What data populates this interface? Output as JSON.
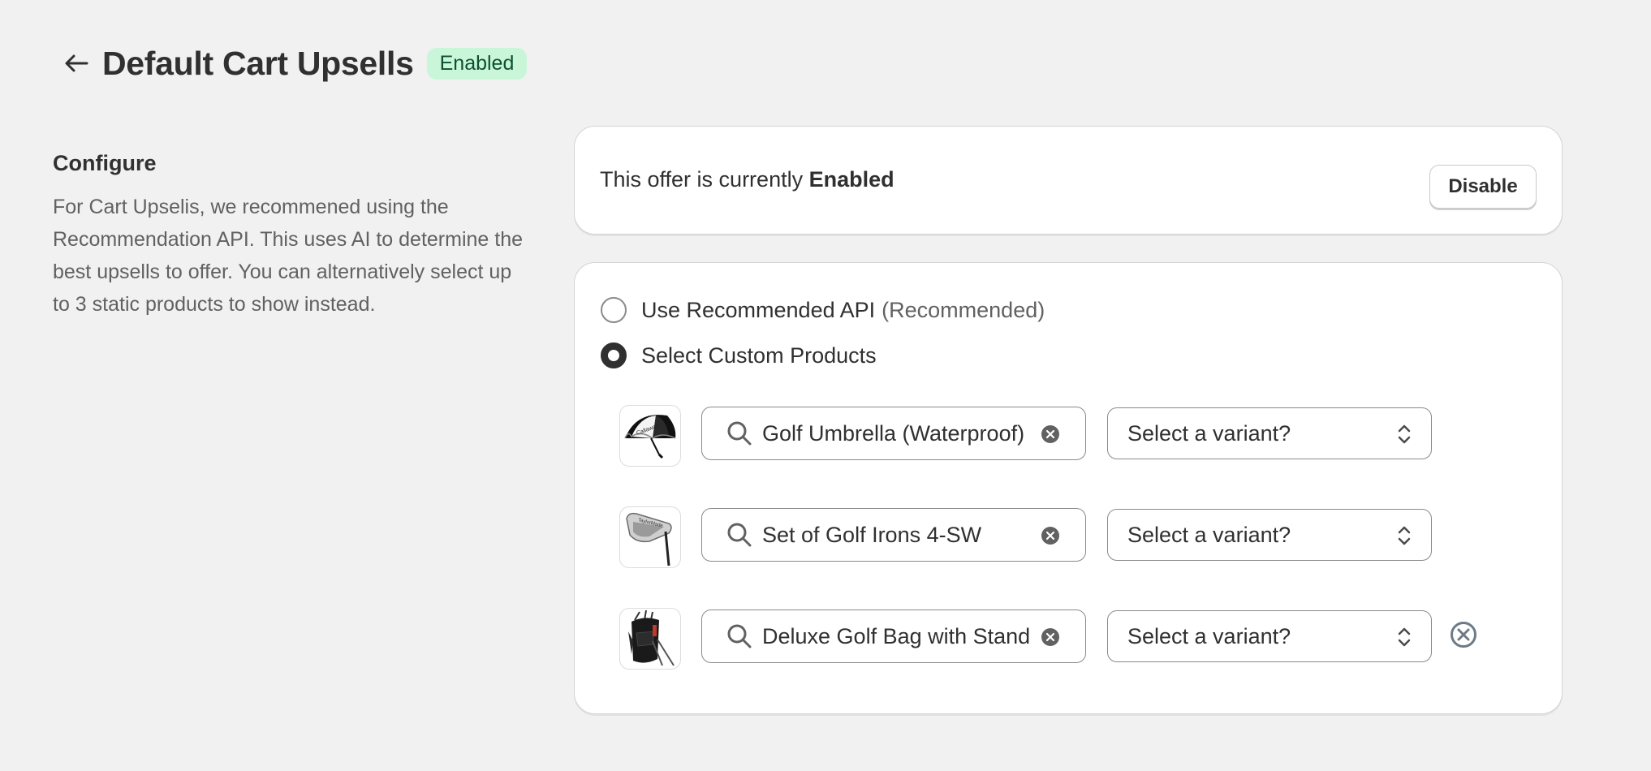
{
  "header": {
    "title": "Default Cart Upsells",
    "badge": "Enabled"
  },
  "configure": {
    "title": "Configure",
    "description": "For Cart Upselis, we recommened using the Recommendation API. This uses AI to determine the best upsells to offer. You can alternatively select up to 3 static products to show instead."
  },
  "status_card": {
    "text_prefix": "This offer is currently ",
    "status": "Enabled",
    "button_label": "Disable"
  },
  "options": {
    "recommended_label": "Use Recommended API",
    "recommended_note": "(Recommended)",
    "custom_label": "Select Custom Products",
    "selected": "custom"
  },
  "products": [
    {
      "name": "Golf Umbrella (Waterproof)",
      "variant_placeholder": "Select a variant?",
      "image": "golf-umbrella"
    },
    {
      "name": "Set of Golf Irons 4-SW",
      "variant_placeholder": "Select a variant?",
      "image": "golf-iron"
    },
    {
      "name": "Deluxe Golf Bag with Stand",
      "variant_placeholder": "Select a variant?",
      "image": "golf-bag"
    }
  ],
  "colors": {
    "background": "#f1f1f2",
    "badge_bg": "#c9f6d8",
    "badge_text": "#0c5132",
    "text": "#303030",
    "muted": "#616161"
  }
}
